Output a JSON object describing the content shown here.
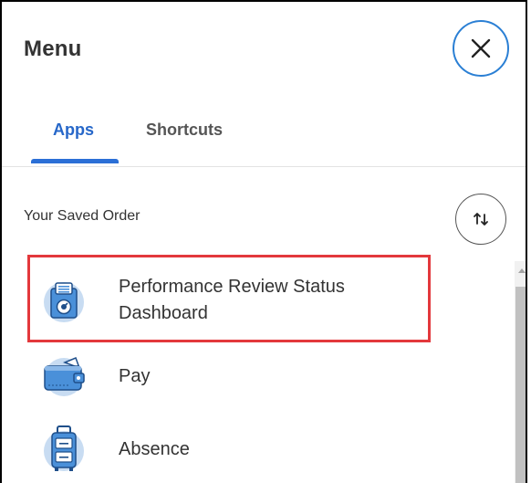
{
  "menu": {
    "title": "Menu",
    "close_icon": "close-icon"
  },
  "tabs": [
    {
      "label": "Apps",
      "active": true
    },
    {
      "label": "Shortcuts",
      "active": false
    }
  ],
  "colors": {
    "accent": "#2b6fd6",
    "highlight": "#e3383c",
    "icon_blue": "#4a90d9",
    "text": "#333333"
  },
  "saved_order": {
    "label": "Your Saved Order",
    "sort_icon": "sort-arrows-icon"
  },
  "apps": [
    {
      "label": "Performance Review Status Dashboard",
      "icon": "dashboard-clipboard-icon",
      "highlighted": true
    },
    {
      "label": "Pay",
      "icon": "wallet-icon",
      "highlighted": false
    },
    {
      "label": "Absence",
      "icon": "suitcase-icon",
      "highlighted": false
    }
  ]
}
